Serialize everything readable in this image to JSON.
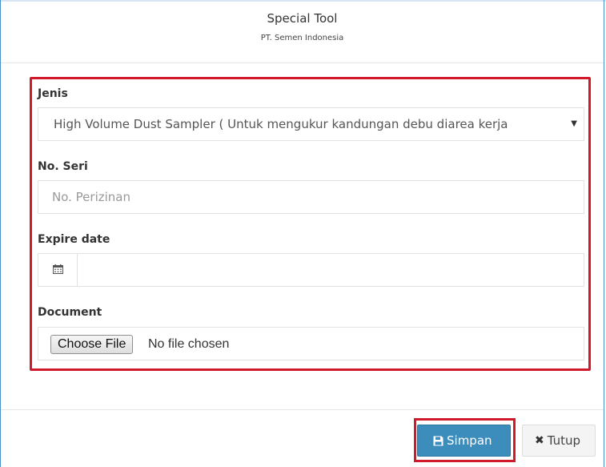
{
  "header": {
    "title": "Special Tool",
    "subtitle": "PT. Semen Indonesia"
  },
  "form": {
    "jenis": {
      "label": "Jenis",
      "selected": "High Volume Dust Sampler ( Untuk mengukur kandungan debu diarea kerja"
    },
    "no_seri": {
      "label": "No. Seri",
      "placeholder": "No. Perizinan",
      "value": ""
    },
    "expire_date": {
      "label": "Expire date",
      "icon": "calendar-icon",
      "value": ""
    },
    "document": {
      "label": "Document",
      "button_label": "Choose File",
      "status": "No file chosen"
    }
  },
  "footer": {
    "save_label": "Simpan",
    "close_label": "Tutup"
  },
  "colors": {
    "accent": "#3c8dbc",
    "highlight": "#d0192a",
    "modal_border": "#4a90c8"
  }
}
